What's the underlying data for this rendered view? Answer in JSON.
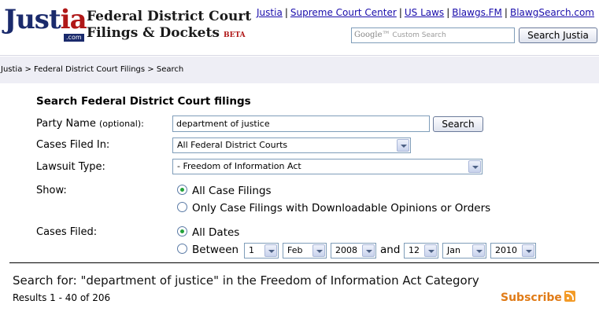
{
  "header": {
    "logo_text_main": "Just",
    "logo_text_accent": "ia",
    "logo_com": ".com",
    "title_line1": "Federal District Court",
    "title_line2": "Filings & Dockets",
    "beta": "BETA",
    "links": [
      "Justia",
      "Supreme Court Center",
      "US Laws",
      "Blawgs.FM",
      "BlawgSearch.com"
    ],
    "search_placeholder_brand": "Google™",
    "search_placeholder": "Custom Search",
    "search_button": "Search Justia"
  },
  "breadcrumb": "Justia > Federal District Court Filings > Search",
  "form": {
    "title": "Search Federal District Court filings",
    "party_label": "Party Name",
    "party_optional": "(optional):",
    "party_value": "department of justice",
    "search_button": "Search",
    "cases_filed_in_label": "Cases Filed In:",
    "cases_filed_in_value": "All Federal District Courts",
    "lawsuit_type_label": "Lawsuit Type:",
    "lawsuit_type_value": "- Freedom of Information Act",
    "show_label": "Show:",
    "show_options": [
      "All Case Filings",
      "Only Case Filings with Downloadable Opinions or Orders"
    ],
    "show_selected": 0,
    "cases_filed_label": "Cases Filed:",
    "date_options": [
      "All Dates",
      "Between"
    ],
    "date_selected": 0,
    "from_day": "1",
    "from_month": "Feb",
    "from_year": "2008",
    "and_label": "and",
    "to_day": "12",
    "to_month": "Jan",
    "to_year": "2010"
  },
  "results": {
    "title": "Search for: \"department of justice\" in the Freedom of Information Act Category",
    "count": "Results 1 - 40 of 206",
    "subscribe": "Subscribe"
  },
  "colors": {
    "brand_navy": "#1a2a6c",
    "brand_red": "#b01818",
    "link": "#1a0dab",
    "subscribe_orange": "#e07b17",
    "crumb_bg": "#eeeef5"
  }
}
